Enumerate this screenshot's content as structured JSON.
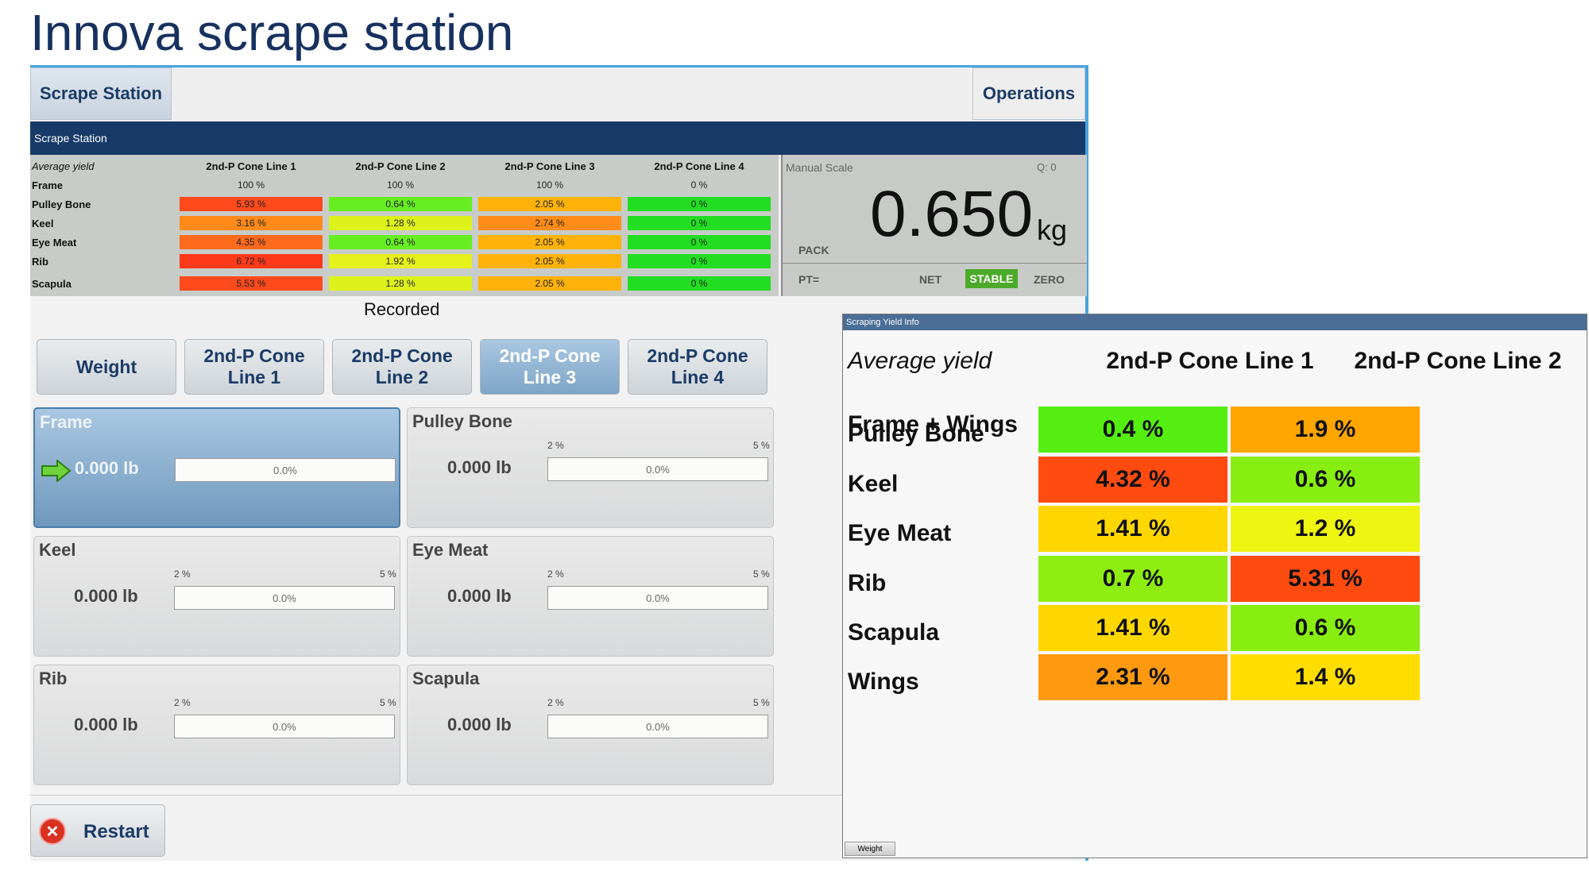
{
  "slide_title": "Innova scrape station",
  "topbar": {
    "scrape_station": "Scrape Station",
    "operations": "Operations"
  },
  "section_title": "Scrape Station",
  "summary": {
    "caption": "Average yield",
    "columns": [
      "2nd-P Cone Line 1",
      "2nd-P Cone Line 2",
      "2nd-P Cone Line 3",
      "2nd-P Cone Line 4"
    ],
    "frame": {
      "label": "Frame",
      "values": [
        "100 %",
        "100 %",
        "100 %",
        "0 %"
      ]
    },
    "rows": [
      {
        "label": "Pulley Bone",
        "values": [
          "5.93 %",
          "0.64 %",
          "2.05 %",
          "0 %"
        ],
        "colors": [
          "#ff4a1c",
          "#66ee22",
          "#ffb20a",
          "#22dd22"
        ]
      },
      {
        "label": "Keel",
        "values": [
          "3.16 %",
          "1.28 %",
          "2.74 %",
          "0 %"
        ],
        "colors": [
          "#ff8a1a",
          "#ddf21a",
          "#ff8c18",
          "#22dd22"
        ]
      },
      {
        "label": "Eye Meat",
        "values": [
          "4.35 %",
          "0.64 %",
          "2.05 %",
          "0 %"
        ],
        "colors": [
          "#ff6a1c",
          "#66ee22",
          "#ffb20a",
          "#22dd22"
        ]
      },
      {
        "label": "Rib",
        "values": [
          "6.72 %",
          "1.92 %",
          "2.05 %",
          "0 %"
        ],
        "colors": [
          "#ff3a1a",
          "#e6f01a",
          "#ffb20a",
          "#22dd22"
        ]
      },
      {
        "label": "Scapula",
        "values": [
          "5.53 %",
          "1.28 %",
          "2.05 %",
          "0 %"
        ],
        "colors": [
          "#ff4a1c",
          "#ddf21a",
          "#ffb20a",
          "#22dd22"
        ]
      }
    ]
  },
  "scale": {
    "label": "Manual Scale",
    "q": "Q:   0",
    "value": "0.650",
    "unit": "kg",
    "pack": "PACK",
    "pt": "PT=",
    "net": "NET",
    "stable": "STABLE",
    "zero": "ZERO"
  },
  "recorded": "Recorded",
  "line_buttons": {
    "weight": "Weight",
    "line1": [
      "2nd-P Cone",
      "Line 1"
    ],
    "line2": [
      "2nd-P Cone",
      "Line 2"
    ],
    "line3": [
      "2nd-P Cone",
      "Line 3"
    ],
    "line4": [
      "2nd-P Cone",
      "Line 4"
    ]
  },
  "parts": [
    {
      "name": "Frame",
      "weight": "0.000 lb",
      "min": "",
      "max": "",
      "percent": "0.0%"
    },
    {
      "name": "Pulley Bone",
      "weight": "0.000 lb",
      "min": "2 %",
      "max": "5 %",
      "percent": "0.0%"
    },
    {
      "name": "Keel",
      "weight": "0.000 lb",
      "min": "2 %",
      "max": "5 %",
      "percent": "0.0%"
    },
    {
      "name": "Eye Meat",
      "weight": "0.000 lb",
      "min": "2 %",
      "max": "5 %",
      "percent": "0.0%"
    },
    {
      "name": "Rib",
      "weight": "0.000 lb",
      "min": "2 %",
      "max": "5 %",
      "percent": "0.0%"
    },
    {
      "name": "Scapula",
      "weight": "0.000 lb",
      "min": "2 %",
      "max": "5 %",
      "percent": "0.0%"
    }
  ],
  "restart": "Restart",
  "yield_info": {
    "title": "Scraping Yield Info",
    "caption": "Average yield",
    "columns": [
      "2nd-P Cone Line 1",
      "2nd-P Cone Line 2"
    ],
    "frame_label": "Frame + Wings",
    "rows": [
      {
        "label": "Pulley Bone",
        "values": [
          "0.4 %",
          "1.9 %"
        ],
        "colors": [
          "#55ee11",
          "#ffa500"
        ]
      },
      {
        "label": "Keel",
        "values": [
          "4.32 %",
          "0.6 %"
        ],
        "colors": [
          "#ff4a10",
          "#88ee11"
        ]
      },
      {
        "label": "Eye Meat",
        "values": [
          "1.41 %",
          "1.2 %"
        ],
        "colors": [
          "#ffd700",
          "#eef511"
        ]
      },
      {
        "label": "Rib",
        "values": [
          "0.7 %",
          "5.31 %"
        ],
        "colors": [
          "#8eee11",
          "#ff4a10"
        ]
      },
      {
        "label": "Scapula",
        "values": [
          "1.41 %",
          "0.6 %"
        ],
        "colors": [
          "#ffd700",
          "#88ee11"
        ]
      },
      {
        "label": "Wings",
        "values": [
          "2.31 %",
          "1.4 %"
        ],
        "colors": [
          "#ff9a10",
          "#ffdd00"
        ]
      }
    ],
    "footer_button": "Weight"
  }
}
